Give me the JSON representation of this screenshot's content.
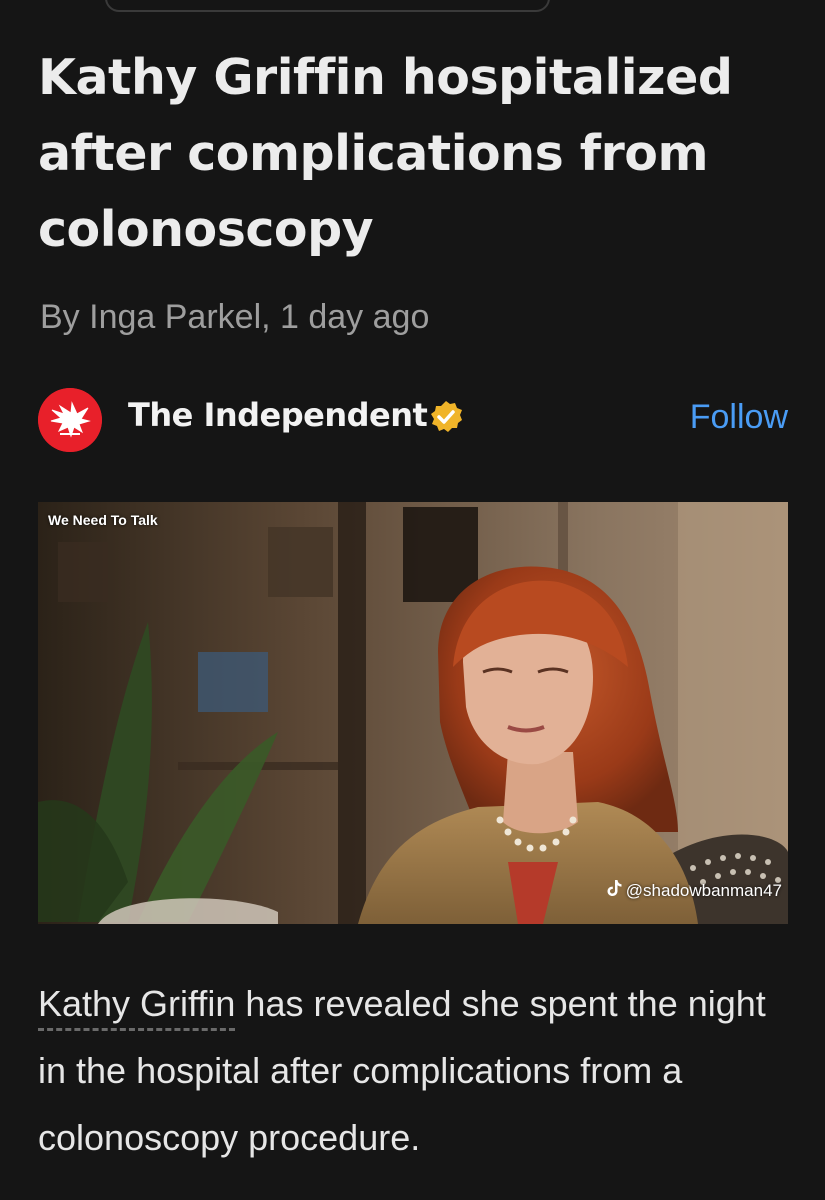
{
  "article": {
    "headline": "Kathy Griffin hospitalized after complications from colonoscopy",
    "byline": "By Inga Parkel,  1 day ago"
  },
  "publisher": {
    "name": "The Independent",
    "logo_icon": "eagle-icon",
    "verified_icon": "verified-badge-icon",
    "follow_label": "Follow"
  },
  "video": {
    "label": "We Need To Talk",
    "watermark_handle": "@shadowbanman47",
    "watermark_icon": "tiktok-icon"
  },
  "lead": {
    "linked_name": "Kathy Griffin",
    "text": " has revealed she spent the night in the hospital after complications from a colonoscopy procedure."
  },
  "colors": {
    "background": "#151515",
    "accent_link": "#4a9cf5",
    "brand_red": "#e8202a",
    "verified_gold": "#f0b429"
  }
}
